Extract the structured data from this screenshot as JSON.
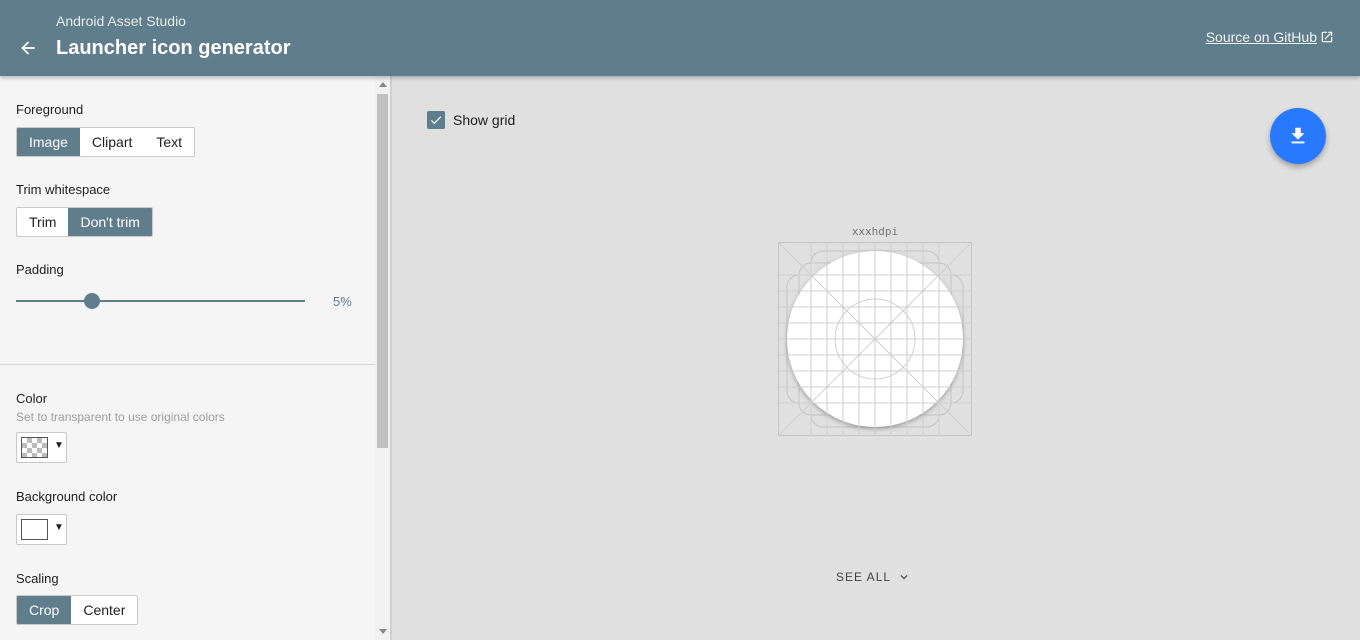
{
  "header": {
    "subtitle": "Android Asset Studio",
    "title": "Launcher icon generator",
    "github_link": "Source on GitHub",
    "background_color": "#607d8b"
  },
  "sidebar": {
    "foreground": {
      "label": "Foreground",
      "options": [
        "Image",
        "Clipart",
        "Text"
      ],
      "selected": "Image"
    },
    "trim": {
      "label": "Trim whitespace",
      "options": [
        "Trim",
        "Don't trim"
      ],
      "selected": "Don't trim"
    },
    "padding": {
      "label": "Padding",
      "value_text": "5%",
      "value_percent": 5
    },
    "color": {
      "label": "Color",
      "hint": "Set to transparent to use original colors",
      "value": "transparent"
    },
    "background_color": {
      "label": "Background color",
      "value": "#ffffff"
    },
    "scaling": {
      "label": "Scaling",
      "options": [
        "Crop",
        "Center"
      ],
      "selected": "Crop"
    }
  },
  "main": {
    "show_grid_label": "Show grid",
    "show_grid_checked": true,
    "density_label": "xxxhdpi",
    "see_all_label": "SEE ALL",
    "fab_color": "#2979ff"
  },
  "icons": {
    "back": "arrow-back-icon",
    "external_link": "open-in-new-icon",
    "download": "download-icon",
    "checkbox": "check-icon",
    "see_all": "chevron-down-icon"
  }
}
